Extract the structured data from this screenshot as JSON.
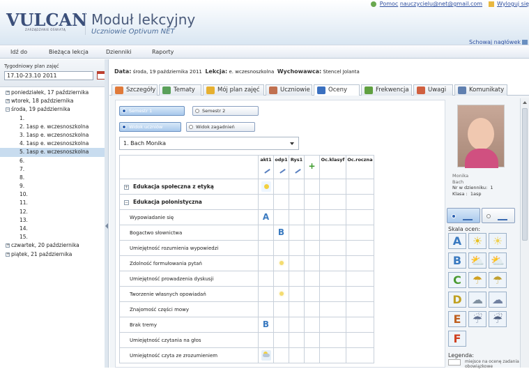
{
  "header": {
    "logo": "VULCAN",
    "logo_sub": "ZARZĄDZANIE OŚWIATĄ",
    "title": "Moduł lekcyjny",
    "subtitle": "Uczniowie Optivum NET",
    "help_label": "Pomoc",
    "email": "nauczycielu@net@gmail.com",
    "logout": "Wyloguj się",
    "hide_header": "Schowaj nagłówek"
  },
  "menu": [
    "Idź do",
    "Bieżąca lekcja",
    "Dzienniki",
    "Raporty"
  ],
  "plan": {
    "label": "Tygodniowy plan zajęć",
    "range": "17.10-23.10 2011"
  },
  "tree": {
    "days": [
      {
        "sign": "+",
        "label": "poniedziałek, 17 października"
      },
      {
        "sign": "+",
        "label": "wtorek, 18 października"
      },
      {
        "sign": "−",
        "label": "środa, 19 października"
      }
    ],
    "lessons": [
      {
        "label": "1.",
        "selected": false
      },
      {
        "label": "2. 1asp  e. wczesnoszkolna",
        "selected": false
      },
      {
        "label": "3. 1asp  e. wczesnoszkolna",
        "selected": false
      },
      {
        "label": "4. 1asp  e. wczesnoszkolna",
        "selected": false
      },
      {
        "label": "5. 1asp  e. wczesnoszkolna",
        "selected": true
      },
      {
        "label": "6.",
        "selected": false
      },
      {
        "label": "7.",
        "selected": false
      },
      {
        "label": "8.",
        "selected": false
      },
      {
        "label": "9.",
        "selected": false
      },
      {
        "label": "10.",
        "selected": false
      },
      {
        "label": "11.",
        "selected": false
      },
      {
        "label": "12.",
        "selected": false
      },
      {
        "label": "13.",
        "selected": false
      },
      {
        "label": "14.",
        "selected": false
      },
      {
        "label": "15.",
        "selected": false
      }
    ],
    "days_after": [
      {
        "sign": "+",
        "label": "czwartek, 20 października"
      },
      {
        "sign": "+",
        "label": "piątek, 21 października"
      }
    ]
  },
  "info": {
    "date_label": "Data:",
    "date": "środa, 19 października 2011",
    "lesson_label": "Lekcja:",
    "lesson": "e. wczesnoszkolna",
    "teacher_label": "Wychowawca:",
    "teacher": "Stencel Jolanta"
  },
  "tabs": [
    {
      "label": "Szczegóły",
      "color": "#e07a3a"
    },
    {
      "label": "Tematy",
      "color": "#5aa05a"
    },
    {
      "label": "Mój plan zajęć",
      "color": "#e6b030"
    },
    {
      "label": "Uczniowie",
      "color": "#c07050"
    },
    {
      "label": "Oceny",
      "color": "#3a70c0",
      "active": true
    },
    {
      "label": "Frekwencja",
      "color": "#60a040"
    },
    {
      "label": "Uwagi",
      "color": "#d06040"
    },
    {
      "label": "Komunikaty",
      "color": "#6080b0"
    }
  ],
  "semesters": {
    "s1": "Semestr 1",
    "s2": "Semestr 2"
  },
  "views": {
    "students": "Widok uczniów",
    "topics": "Widok zagadnień"
  },
  "student_select": "1. Bach Monika",
  "grid": {
    "columns": [
      "akt1",
      "odp1",
      "Rys1",
      "",
      "Oc.klasyf",
      "Oc.roczna"
    ],
    "rows": [
      {
        "label": "Edukacja społeczna z etyką",
        "type": "group",
        "sign": "+",
        "grades": {
          "akt1": "sun"
        }
      },
      {
        "label": "Edukacja polonistyczna",
        "type": "group",
        "sign": "−",
        "grades": {}
      },
      {
        "label": "Wypowiadanie się",
        "type": "item",
        "grades": {
          "akt1": "A"
        }
      },
      {
        "label": "Bogactwo słownictwa",
        "type": "item",
        "grades": {
          "odp1": "B"
        }
      },
      {
        "label": "Umiejętność rozumienia wypowiedzi",
        "type": "item",
        "grades": {}
      },
      {
        "label": "Zdolność formułowania pytań",
        "type": "item",
        "grades": {
          "odp1": "sunsm"
        }
      },
      {
        "label": "Umiejętność prowadzenia dyskusji",
        "type": "item",
        "grades": {}
      },
      {
        "label": "Tworzenie własnych opowiadań",
        "type": "item",
        "grades": {
          "odp1": "sunsm"
        }
      },
      {
        "label": "Znajomość części mowy",
        "type": "item",
        "grades": {}
      },
      {
        "label": "Brak tremy",
        "type": "item",
        "grades": {
          "akt1": "B"
        }
      },
      {
        "label": "Umiejętność czytania na głos",
        "type": "item",
        "grades": {}
      },
      {
        "label": "Umiejętność czyta ze zrozumieniem",
        "type": "item",
        "grades": {
          "akt1": "cloud"
        }
      }
    ]
  },
  "student_card": {
    "first_name": "Monika",
    "last_name": "Bach",
    "journal_no_label": "Nr w dzienniku:",
    "journal_no": "1",
    "class_label": "Klasa :",
    "class": "1asp"
  },
  "scale_label": "Skala ocen:",
  "scale": [
    {
      "g": "A",
      "c": "#3a7ac0"
    },
    {
      "g": "☀",
      "c": "#e8c020"
    },
    {
      "g": "☀",
      "c": "#f0d050"
    },
    {
      "g": "B",
      "c": "#3a7ac0"
    },
    {
      "g": "⛅",
      "c": "#e8c020"
    },
    {
      "g": "⛅",
      "c": "#c0c8d0"
    },
    {
      "g": "C",
      "c": "#4a9a30"
    },
    {
      "g": "☂",
      "c": "#d0a020"
    },
    {
      "g": "☂",
      "c": "#c0a030"
    },
    {
      "g": "D",
      "c": "#c0a020"
    },
    {
      "g": "☁",
      "c": "#8090a0"
    },
    {
      "g": "☁",
      "c": "#7080a0"
    },
    {
      "g": "E",
      "c": "#c06020"
    },
    {
      "g": "☔",
      "c": "#607090"
    },
    {
      "g": "☔",
      "c": "#506080"
    },
    {
      "g": "F",
      "c": "#d04020"
    }
  ],
  "legend_label": "Legenda:",
  "legend_text": "miejsce na ocenę zadania obowiązkowe"
}
